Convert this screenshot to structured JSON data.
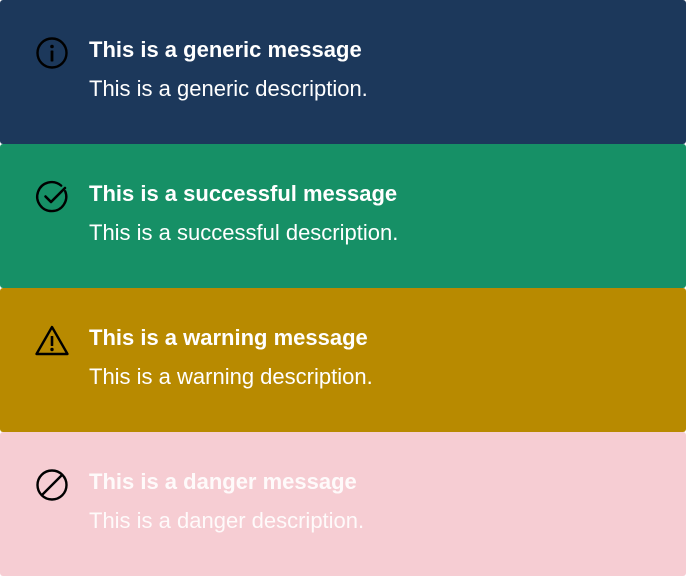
{
  "alerts": [
    {
      "kind": "generic",
      "icon": "info-icon",
      "title": "This is a generic message",
      "description": "This is a generic description.",
      "background": "#1c385b"
    },
    {
      "kind": "success",
      "icon": "check-circle-icon",
      "title": "This is a successful message",
      "description": "This is a successful description.",
      "background": "#169066"
    },
    {
      "kind": "warning",
      "icon": "warning-triangle-icon",
      "title": "This is a warning message",
      "description": "This is a warning description.",
      "background": "#b88a00"
    },
    {
      "kind": "danger",
      "icon": "prohibited-icon",
      "title": "This is a danger message",
      "description": "This is a danger description.",
      "background": "#f6cdd3"
    }
  ]
}
